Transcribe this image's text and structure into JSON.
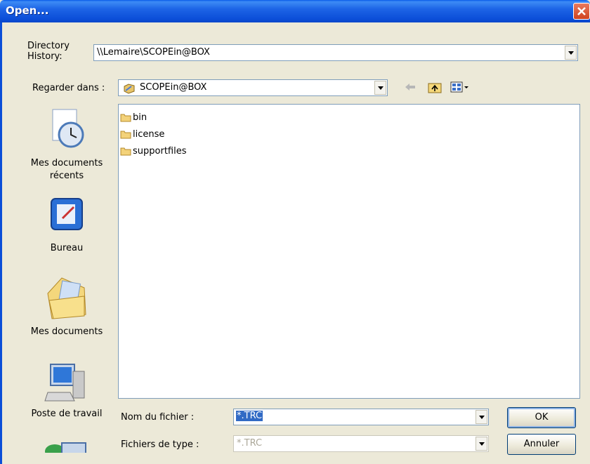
{
  "window": {
    "title": "Open..."
  },
  "directory_history": {
    "label": "Directory History:",
    "value": "\\\\Lemaire\\SCOPEin@BOX"
  },
  "look_in": {
    "label": "Regarder dans :",
    "value": "SCOPEin@BOX"
  },
  "places": [
    {
      "label": "Mes documents récents",
      "icon": "recent-documents-icon"
    },
    {
      "label": "Bureau",
      "icon": "desktop-icon"
    },
    {
      "label": "Mes documents",
      "icon": "my-documents-icon"
    },
    {
      "label": "Poste de travail",
      "icon": "my-computer-icon"
    }
  ],
  "files": [
    {
      "name": "bin",
      "icon": "folder-icon"
    },
    {
      "name": "license",
      "icon": "folder-icon"
    },
    {
      "name": "supportfiles",
      "icon": "folder-icon"
    }
  ],
  "filename": {
    "label": "Nom du fichier :",
    "value": "*.TRC"
  },
  "filetype": {
    "label": "Fichiers de type :",
    "value": "*.TRC"
  },
  "buttons": {
    "ok": "OK",
    "cancel": "Annuler"
  }
}
